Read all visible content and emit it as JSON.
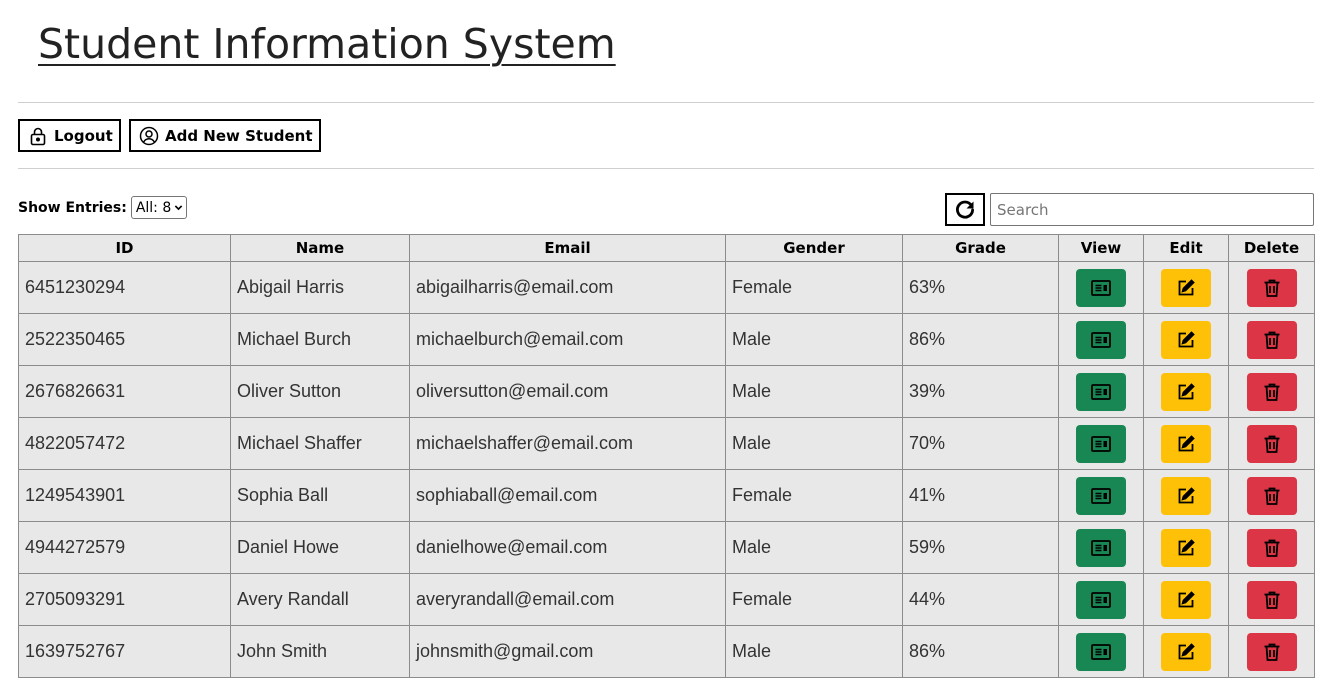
{
  "page": {
    "title": "Student Information System"
  },
  "toolbar": {
    "logout_label": "Logout",
    "add_label": "Add New Student"
  },
  "filters": {
    "show_entries_label": "Show Entries:",
    "entries_value": "All: 8",
    "search_placeholder": "Search"
  },
  "table": {
    "columns": [
      "ID",
      "Name",
      "Email",
      "Gender",
      "Grade",
      "View",
      "Edit",
      "Delete"
    ],
    "rows": [
      {
        "id": "6451230294",
        "name": "Abigail Harris",
        "email": "abigailharris@email.com",
        "gender": "Female",
        "grade": "63%"
      },
      {
        "id": "2522350465",
        "name": "Michael Burch",
        "email": "michaelburch@email.com",
        "gender": "Male",
        "grade": "86%"
      },
      {
        "id": "2676826631",
        "name": "Oliver Sutton",
        "email": "oliversutton@email.com",
        "gender": "Male",
        "grade": "39%"
      },
      {
        "id": "4822057472",
        "name": "Michael Shaffer",
        "email": "michaelshaffer@email.com",
        "gender": "Male",
        "grade": "70%"
      },
      {
        "id": "1249543901",
        "name": "Sophia Ball",
        "email": "sophiaball@email.com",
        "gender": "Female",
        "grade": "41%"
      },
      {
        "id": "4944272579",
        "name": "Daniel Howe",
        "email": "danielhowe@email.com",
        "gender": "Male",
        "grade": "59%"
      },
      {
        "id": "2705093291",
        "name": "Avery Randall",
        "email": "averyrandall@email.com",
        "gender": "Female",
        "grade": "44%"
      },
      {
        "id": "1639752767",
        "name": "John Smith",
        "email": "johnsmith@gmail.com",
        "gender": "Male",
        "grade": "86%"
      }
    ]
  },
  "colors": {
    "view": "#198754",
    "edit": "#ffc107",
    "delete": "#dc3545"
  },
  "icons": [
    "lock-icon",
    "user-circle-icon",
    "chevron-down-icon",
    "refresh-icon",
    "id-card-icon",
    "pencil-square-icon",
    "trash-icon"
  ]
}
